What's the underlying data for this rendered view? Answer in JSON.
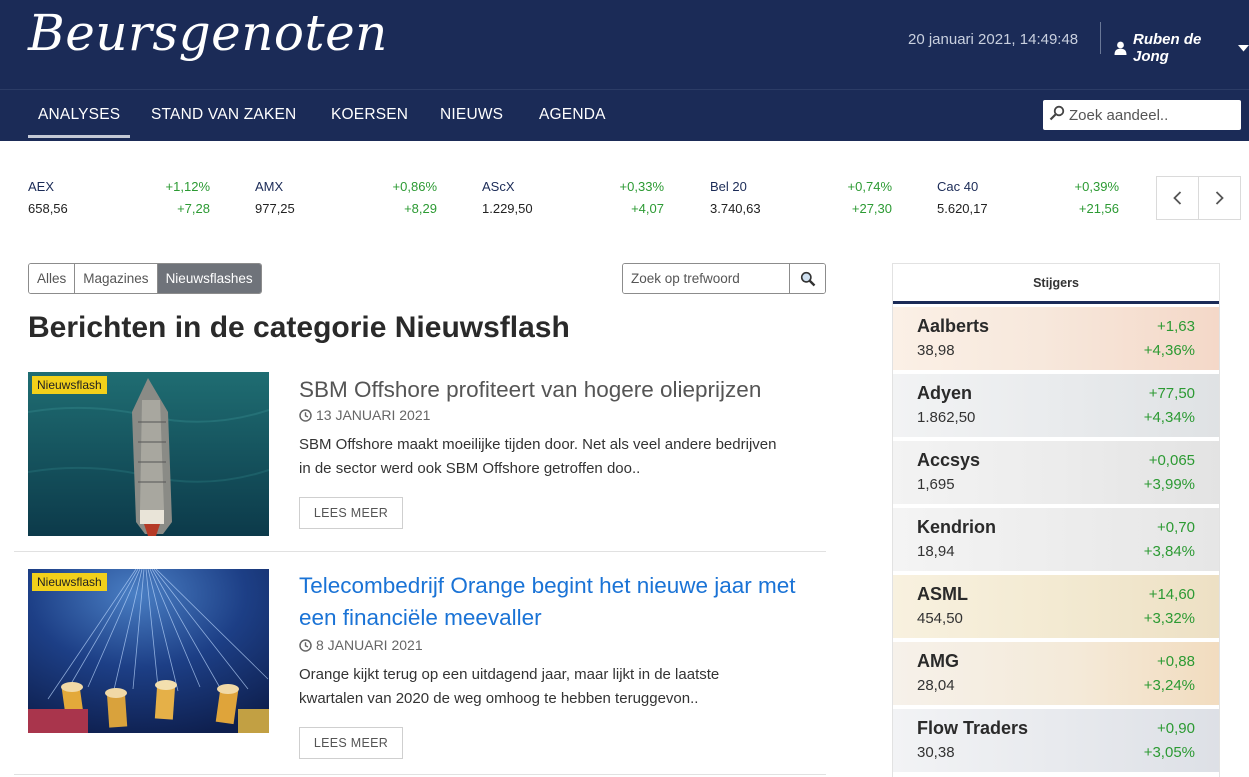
{
  "header": {
    "logo": "Beursgenoten",
    "datetime": "20 januari 2021, 14:49:48",
    "user_name": "Ruben de Jong"
  },
  "nav": {
    "items": [
      "ANALYSES",
      "STAND VAN ZAKEN",
      "KOERSEN",
      "NIEUWS",
      "AGENDA"
    ],
    "active": "ANALYSES",
    "search_placeholder": "Zoek aandeel.."
  },
  "ticker": [
    {
      "name": "AEX",
      "value": "658,56",
      "pct": "+1,12%",
      "abs": "+7,28"
    },
    {
      "name": "AMX",
      "value": "977,25",
      "pct": "+0,86%",
      "abs": "+8,29"
    },
    {
      "name": "AScX",
      "value": "1.229,50",
      "pct": "+0,33%",
      "abs": "+4,07"
    },
    {
      "name": "Bel 20",
      "value": "3.740,63",
      "pct": "+0,74%",
      "abs": "+27,30"
    },
    {
      "name": "Cac 40",
      "value": "5.620,17",
      "pct": "+0,39%",
      "abs": "+21,56"
    }
  ],
  "filters": {
    "tabs": [
      "Alles",
      "Magazines",
      "Nieuwsflashes"
    ],
    "active": "Nieuwsflashes",
    "keyword_placeholder": "Zoek op trefwoord"
  },
  "page_title": "Berichten in de categorie Nieuwsflash",
  "articles": [
    {
      "badge": "Nieuwsflash",
      "title": "SBM Offshore profiteert van hogere olieprijzen",
      "date": "13 JANUARI 2021",
      "excerpt": "SBM Offshore maakt moeilijke tijden door. Net als veel andere bedrijven in de sector werd ook SBM Offshore getroffen doo..",
      "button": "LEES MEER",
      "title_color": "#555555"
    },
    {
      "badge": "Nieuwsflash",
      "title": "Telecombedrijf Orange begint het nieuwe jaar met een financiële meevaller",
      "date": "8 JANUARI 2021",
      "excerpt": "Orange kijkt terug op een uitdagend jaar, maar lijkt in de laatste kwartalen van 2020 de weg omhoog te hebben teruggevon..",
      "button": "LEES MEER",
      "title_color": "#1a73d6"
    }
  ],
  "sidebar": {
    "title": "Stijgers",
    "stocks": [
      {
        "name": "Aalberts",
        "value": "38,98",
        "abs": "+1,63",
        "pct": "+4,36%"
      },
      {
        "name": "Adyen",
        "value": "1.862,50",
        "abs": "+77,50",
        "pct": "+4,34%"
      },
      {
        "name": "Accsys",
        "value": "1,695",
        "abs": "+0,065",
        "pct": "+3,99%"
      },
      {
        "name": "Kendrion",
        "value": "18,94",
        "abs": "+0,70",
        "pct": "+3,84%"
      },
      {
        "name": "ASML",
        "value": "454,50",
        "abs": "+14,60",
        "pct": "+3,32%"
      },
      {
        "name": "AMG",
        "value": "28,04",
        "abs": "+0,88",
        "pct": "+3,24%"
      },
      {
        "name": "Flow Traders",
        "value": "30,38",
        "abs": "+0,90",
        "pct": "+3,05%"
      }
    ]
  },
  "colors": {
    "navy": "#1b2b57",
    "positive": "#2c9a33",
    "badge": "#f2d01a",
    "link": "#1a73d6"
  }
}
